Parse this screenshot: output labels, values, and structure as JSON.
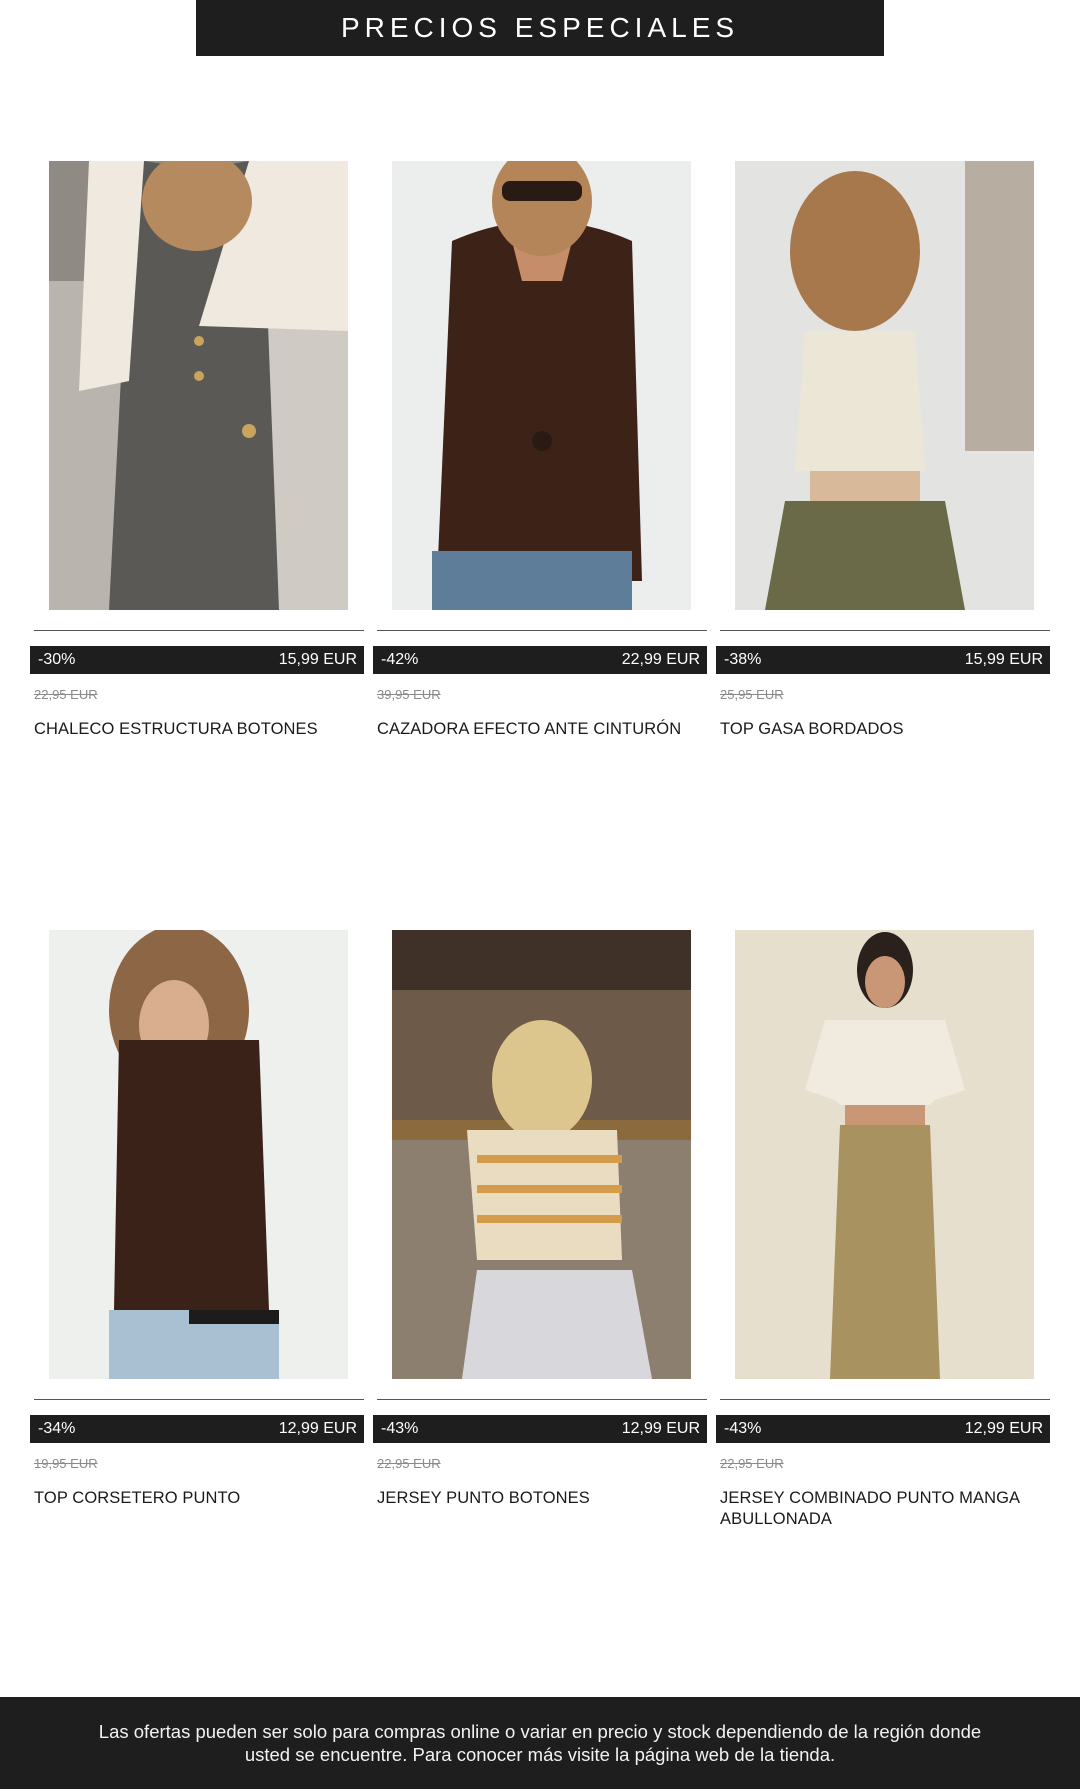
{
  "banner": {
    "title": "PRECIOS ESPECIALES"
  },
  "products": [
    {
      "discount": "-30%",
      "price": "15,99 EUR",
      "old_price": "22,95 EUR",
      "name": "CHALECO ESTRUCTURA BOTONES",
      "image": "tweed-vest-model",
      "bg": "#b9b4ad",
      "garment": "#5a5955",
      "accent": "#efe9e0"
    },
    {
      "discount": "-42%",
      "price": "22,99 EUR",
      "old_price": "39,95 EUR",
      "name": "CAZADORA EFECTO ANTE CINTURÓN",
      "image": "suede-jacket-model",
      "bg": "#eceeed",
      "garment": "#3d2218",
      "accent": "#5d7d98"
    },
    {
      "discount": "-38%",
      "price": "15,99 EUR",
      "old_price": "25,95 EUR",
      "name": "TOP GASA BORDADOS",
      "image": "embroidered-top-model",
      "bg": "#e3e3e1",
      "garment": "#ece6d6",
      "accent": "#6b6a48"
    },
    {
      "discount": "-34%",
      "price": "12,99 EUR",
      "old_price": "19,95 EUR",
      "name": "TOP CORSETERO PUNTO",
      "image": "corset-top-model",
      "bg": "#eef0ee",
      "garment": "#3a2219",
      "accent": "#a9bfd2"
    },
    {
      "discount": "-43%",
      "price": "12,99 EUR",
      "old_price": "22,95 EUR",
      "name": "JERSEY PUNTO BOTONES",
      "image": "striped-jersey-model",
      "bg": "#6e5a48",
      "garment": "#e9dcc0",
      "accent": "#d8d8dc"
    },
    {
      "discount": "-43%",
      "price": "12,99 EUR",
      "old_price": "22,95 EUR",
      "name": "JERSEY COMBINADO PUNTO MANGA ABULLONADA",
      "image": "puff-sleeve-jersey-model",
      "bg": "#e7dfce",
      "garment": "#f1ebdf",
      "accent": "#a8925f"
    }
  ],
  "footer": {
    "text": "Las ofertas pueden ser solo para compras online o variar en precio y stock dependiendo de la región donde usted se encuentre. Para conocer más visite la página web de la tienda."
  }
}
